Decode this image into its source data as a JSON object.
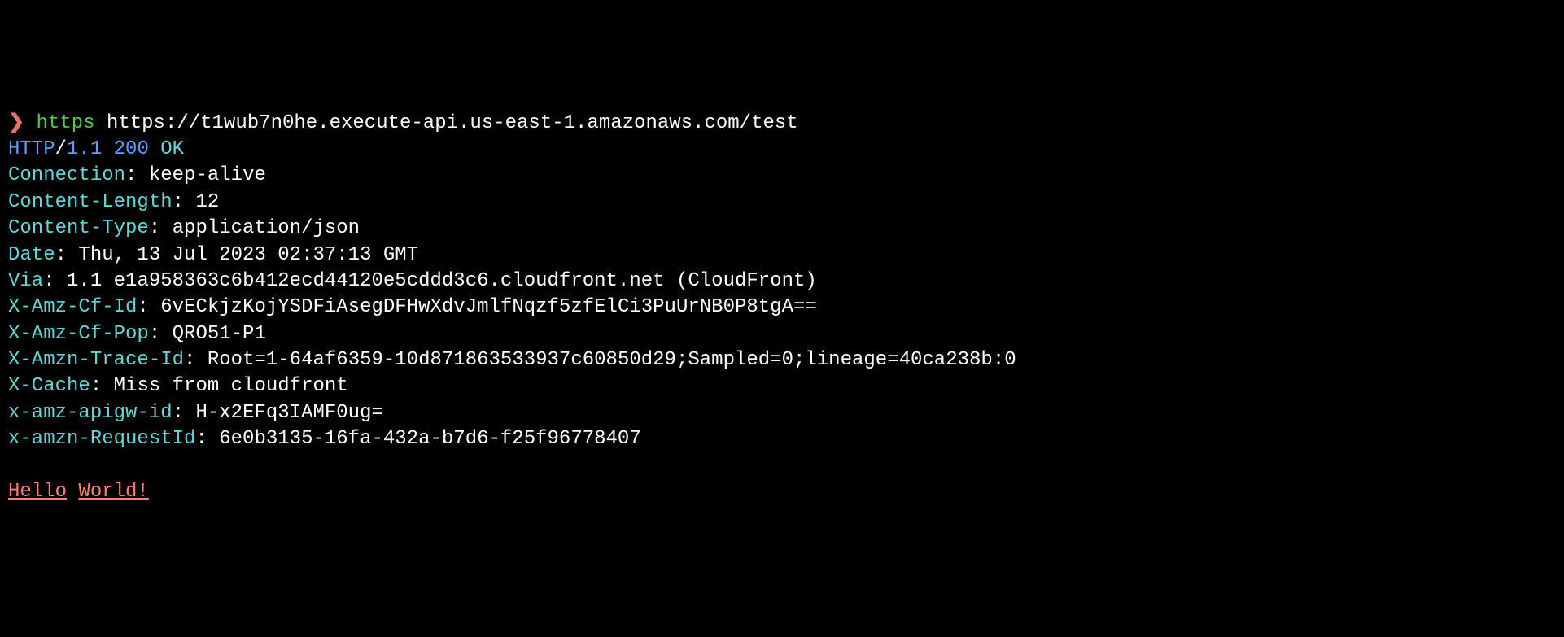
{
  "prompt": {
    "caret": "❯",
    "command": "https",
    "arg": "https://t1wub7n0he.execute-api.us-east-1.amazonaws.com/test"
  },
  "status": {
    "protocol": "HTTP",
    "slash": "/",
    "version": "1.1",
    "code": "200",
    "text": "OK"
  },
  "headers": [
    {
      "key": "Connection",
      "value": "keep-alive"
    },
    {
      "key": "Content-Length",
      "value": "12"
    },
    {
      "key": "Content-Type",
      "value": "application/json"
    },
    {
      "key": "Date",
      "value": "Thu, 13 Jul 2023 02:37:13 GMT"
    },
    {
      "key": "Via",
      "value": "1.1 e1a958363c6b412ecd44120e5cddd3c6.cloudfront.net (CloudFront)"
    },
    {
      "key": "X-Amz-Cf-Id",
      "value": "6vECkjzKojYSDFiAsegDFHwXdvJmlfNqzf5zfElCi3PuUrNB0P8tgA=="
    },
    {
      "key": "X-Amz-Cf-Pop",
      "value": "QRO51-P1"
    },
    {
      "key": "X-Amzn-Trace-Id",
      "value": "Root=1-64af6359-10d871863533937c60850d29;Sampled=0;lineage=40ca238b:0"
    },
    {
      "key": "X-Cache",
      "value": "Miss from cloudfront"
    },
    {
      "key": "x-amz-apigw-id",
      "value": "H-x2EFq3IAMF0ug="
    },
    {
      "key": "x-amzn-RequestId",
      "value": "6e0b3135-16fa-432a-b7d6-f25f96778407"
    }
  ],
  "body": {
    "word1": "Hello",
    "word2": "World!"
  }
}
